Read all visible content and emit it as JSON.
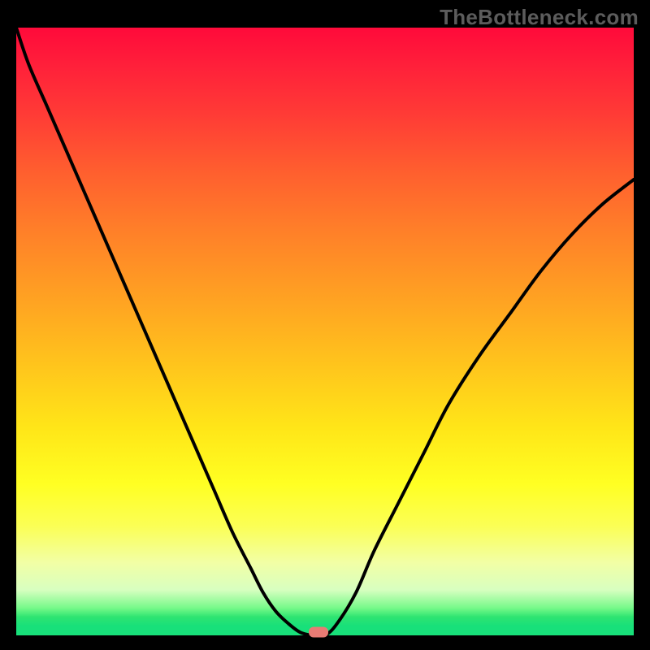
{
  "watermark": "TheBottleneck.com",
  "chart_data": {
    "type": "line",
    "title": "",
    "xlabel": "",
    "ylabel": "",
    "x": [
      0.0,
      0.02,
      0.05,
      0.08,
      0.11,
      0.14,
      0.17,
      0.2,
      0.23,
      0.26,
      0.29,
      0.32,
      0.35,
      0.38,
      0.4,
      0.42,
      0.44,
      0.46,
      0.48,
      0.5,
      0.52,
      0.55,
      0.58,
      0.62,
      0.66,
      0.7,
      0.75,
      0.8,
      0.85,
      0.9,
      0.95,
      1.0
    ],
    "y": [
      1.0,
      0.94,
      0.87,
      0.8,
      0.73,
      0.66,
      0.59,
      0.52,
      0.45,
      0.38,
      0.31,
      0.24,
      0.17,
      0.11,
      0.07,
      0.04,
      0.02,
      0.005,
      0.0,
      0.0,
      0.02,
      0.07,
      0.14,
      0.22,
      0.3,
      0.38,
      0.46,
      0.53,
      0.6,
      0.66,
      0.71,
      0.75
    ],
    "xlim": [
      0,
      1
    ],
    "ylim": [
      0,
      1
    ],
    "marker": {
      "x": 0.49,
      "y": 0.0
    },
    "colors": {
      "curve": "#000000",
      "marker": "#e87b74",
      "gradient_top": "#ff0a3a",
      "gradient_bottom": "#18e07a"
    }
  }
}
